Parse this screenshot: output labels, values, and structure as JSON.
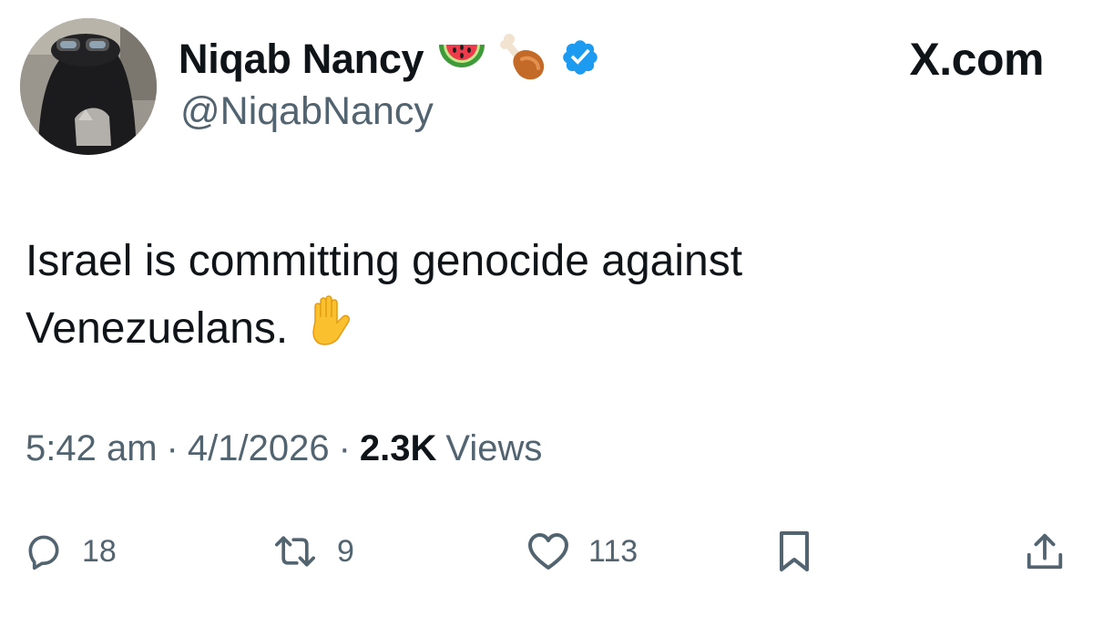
{
  "user": {
    "display_name": "Niqab Nancy",
    "handle": "@NiqabNancy",
    "name_emojis": [
      "watermelon-emoji",
      "poultry-leg-emoji"
    ],
    "verified": true
  },
  "brand": "X.com",
  "tweet": {
    "lines": [
      "Israel is committing genocide against",
      "Venezuelans."
    ],
    "trailing_emoji": "raised-hand-emoji"
  },
  "meta": {
    "time": "5:42 am",
    "separator": "·",
    "date": "4/1/2026",
    "views_count": "2.3K",
    "views_label": "Views"
  },
  "actions": {
    "replies": "18",
    "reposts": "9",
    "likes": "113"
  },
  "colors": {
    "text": "#0f1419",
    "secondary": "#536471",
    "verified": "#1d9bf0"
  }
}
